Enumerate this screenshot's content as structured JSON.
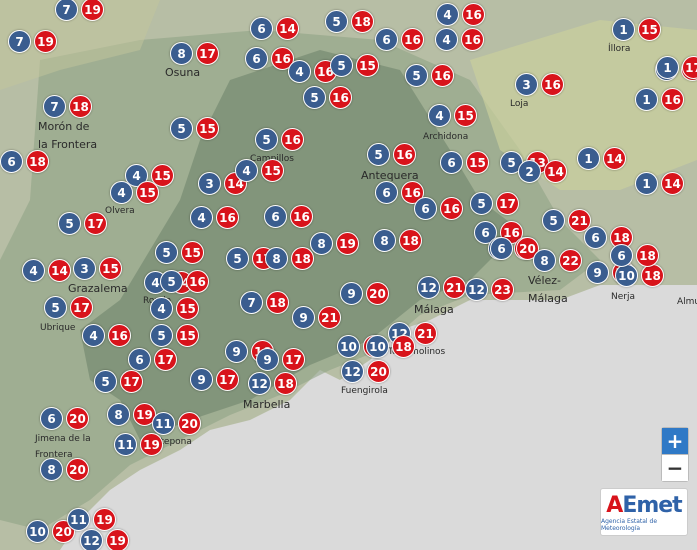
{
  "colors": {
    "min": "#3a5d8f",
    "max": "#d8131b",
    "sea": "#dadada",
    "land": "#b7bea5"
  },
  "places": [
    {
      "name": "Osuna"
    },
    {
      "name": "Íllora"
    },
    {
      "name": "Morón de"
    },
    {
      "name": "la Frontera"
    },
    {
      "name": "Loja"
    },
    {
      "name": "Archidona"
    },
    {
      "name": "Campillos"
    },
    {
      "name": "Antequera"
    },
    {
      "name": "Olvera"
    },
    {
      "name": "Grazalema"
    },
    {
      "name": "Ronda"
    },
    {
      "name": "Ubrique"
    },
    {
      "name": "Vélez-"
    },
    {
      "name": "Málaga"
    },
    {
      "name": "Málaga"
    },
    {
      "name": "Nerja"
    },
    {
      "name": "Almu"
    },
    {
      "name": "Torremolinos"
    },
    {
      "name": "Fuengirola"
    },
    {
      "name": "Marbella"
    },
    {
      "name": "Jimena de la"
    },
    {
      "name": "Frontera"
    },
    {
      "name": "Estepona"
    }
  ],
  "temps": [
    {
      "min": 7,
      "max": 19
    },
    {
      "min": 7,
      "max": 19
    },
    {
      "min": 6,
      "max": 14
    },
    {
      "min": 5,
      "max": 18
    },
    {
      "min": 6,
      "max": 16
    },
    {
      "min": 4,
      "max": 16
    },
    {
      "min": 1,
      "max": 15
    },
    {
      "min": 8,
      "max": 17
    },
    {
      "min": 6,
      "max": 16
    },
    {
      "min": 4,
      "max": 16
    },
    {
      "min": 5,
      "max": 15
    },
    {
      "min": 4,
      "max": 16
    },
    {
      "min": 5,
      "max": 16
    },
    {
      "min": 1,
      "max": 17
    },
    {
      "min": 5,
      "max": 16
    },
    {
      "min": 3,
      "max": 16
    },
    {
      "min": 1,
      "max": 16
    },
    {
      "min": 7,
      "max": 18
    },
    {
      "min": 5,
      "max": 15
    },
    {
      "min": 5,
      "max": 16
    },
    {
      "min": 4,
      "max": 15
    },
    {
      "min": 6,
      "max": 18
    },
    {
      "min": 4,
      "max": 15
    },
    {
      "min": 5,
      "max": 16
    },
    {
      "min": 6,
      "max": 15
    },
    {
      "min": 4,
      "max": 15
    },
    {
      "min": 5,
      "max": 13
    },
    {
      "min": 2,
      "max": 14
    },
    {
      "min": 1,
      "max": 14
    },
    {
      "min": 1,
      "max": 14
    },
    {
      "min": 3,
      "max": 14
    },
    {
      "min": 4,
      "max": 15
    },
    {
      "min": 4,
      "max": 16
    },
    {
      "min": 6,
      "max": 16
    },
    {
      "min": 6,
      "max": 16
    },
    {
      "min": 6,
      "max": 16
    },
    {
      "min": 5,
      "max": 17
    },
    {
      "min": 4,
      "max": 14
    },
    {
      "min": 6,
      "max": 16
    },
    {
      "min": 8,
      "max": 17
    },
    {
      "min": 5,
      "max": 21
    },
    {
      "min": 6,
      "max": 18
    },
    {
      "min": 5,
      "max": 15
    },
    {
      "min": 5,
      "max": 16
    },
    {
      "min": 8,
      "max": 19
    },
    {
      "min": 8,
      "max": 18
    },
    {
      "min": 6,
      "max": 20
    },
    {
      "min": 5,
      "max": 17
    },
    {
      "min": 8,
      "max": 18
    },
    {
      "min": 5,
      "max": 17
    },
    {
      "min": 3,
      "max": 15
    },
    {
      "min": 4,
      "max": 14
    },
    {
      "min": 8,
      "max": 22
    },
    {
      "min": 9,
      "max": 17
    },
    {
      "min": 10,
      "max": 18
    },
    {
      "min": 5,
      "max": 17
    },
    {
      "min": 4,
      "max": 15
    },
    {
      "min": 7,
      "max": 18
    },
    {
      "min": 9,
      "max": 20
    },
    {
      "min": 12,
      "max": 21
    },
    {
      "min": 12,
      "max": 23
    },
    {
      "min": 4,
      "max": 16
    },
    {
      "min": 5,
      "max": 15
    },
    {
      "min": 9,
      "max": 21
    },
    {
      "min": 12,
      "max": 21
    },
    {
      "min": 6,
      "max": 17
    },
    {
      "min": 9,
      "max": 16
    },
    {
      "min": 9,
      "max": 17
    },
    {
      "min": 10,
      "max": 17
    },
    {
      "min": 10,
      "max": 18
    },
    {
      "min": 5,
      "max": 17
    },
    {
      "min": 9,
      "max": 17
    },
    {
      "min": 12,
      "max": 18
    },
    {
      "min": 12,
      "max": 20
    },
    {
      "min": 6,
      "max": 20
    },
    {
      "min": 8,
      "max": 19
    },
    {
      "min": 11,
      "max": 20
    },
    {
      "min": 11,
      "max": 19
    },
    {
      "min": 8,
      "max": 20
    },
    {
      "min": 10,
      "max": 20
    },
    {
      "min": 11,
      "max": 19
    },
    {
      "min": 12,
      "max": 19
    },
    {
      "min": 1,
      "max": 17
    },
    {
      "min": 6,
      "max": 18
    }
  ],
  "zoom": {
    "in_label": "+",
    "out_label": "−"
  },
  "logo": {
    "name_a": "A",
    "name_rest": "Emet",
    "subtitle": "Agencia Estatal de Meteorología"
  }
}
